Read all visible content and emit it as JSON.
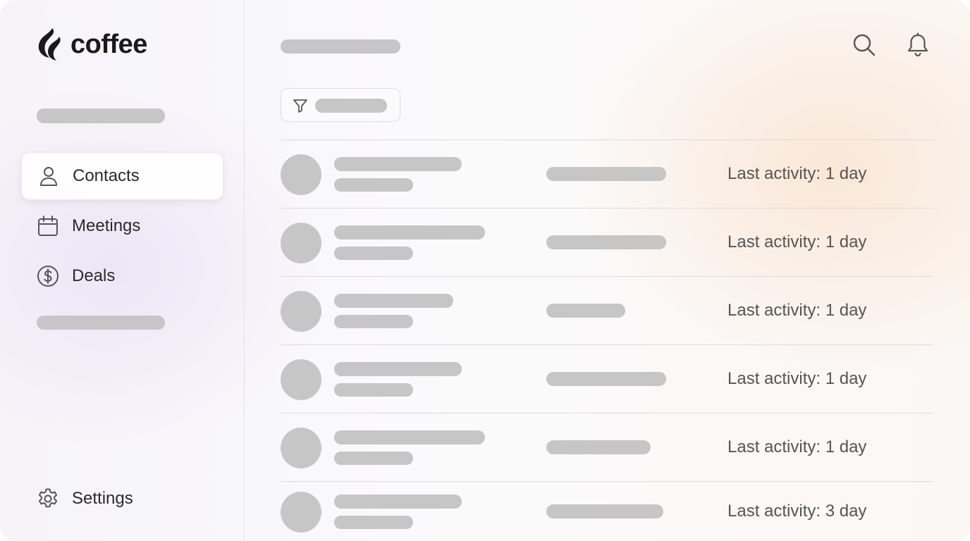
{
  "app": {
    "name": "coffee"
  },
  "sidebar": {
    "items": [
      {
        "label": "Contacts",
        "icon": "person-icon",
        "active": true
      },
      {
        "label": "Meetings",
        "icon": "calendar-icon",
        "active": false
      },
      {
        "label": "Deals",
        "icon": "dollar-icon",
        "active": false
      }
    ],
    "settings": {
      "label": "Settings",
      "icon": "gear-icon"
    }
  },
  "header": {
    "icons": [
      "search-icon",
      "bell-icon"
    ]
  },
  "toolbar": {
    "filter_icon": "filter-icon"
  },
  "contacts": {
    "rows": [
      {
        "activity": "Last activity: 1 day"
      },
      {
        "activity": "Last activity: 1 day"
      },
      {
        "activity": "Last activity: 1 day"
      },
      {
        "activity": "Last activity: 1 day"
      },
      {
        "activity": "Last activity: 1 day"
      },
      {
        "activity": "Last activity: 3 day"
      }
    ]
  },
  "colors": {
    "placeholder": "#c6c6c6",
    "text": "#2a2a2a",
    "muted_text": "#555555",
    "divider": "#dedbdf"
  }
}
